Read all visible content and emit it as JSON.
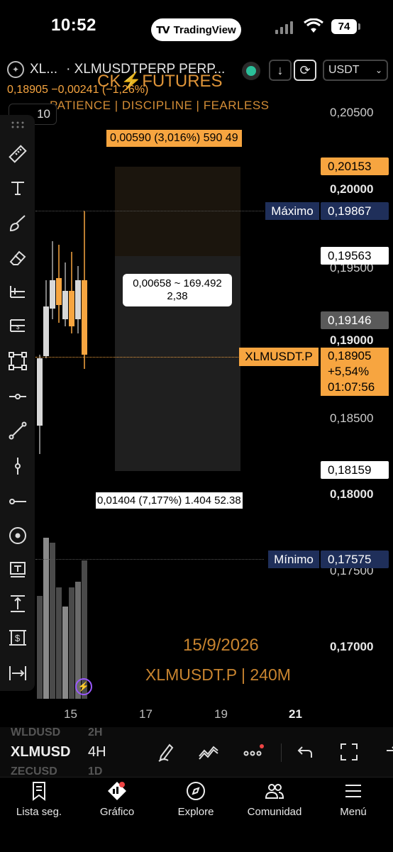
{
  "status": {
    "time": "10:52",
    "app_pill": "TradingView",
    "battery": "74"
  },
  "header": {
    "symbol_short": "XL...",
    "symbol_full": "· XLMUSDTPERP PERP...",
    "currency": "USDT",
    "price_line": "0,18905 −0,00241 (−1,26%)",
    "interval": "10"
  },
  "watermark": {
    "title": "CK⚡FUTURES",
    "subtitle": "PATIENCE | DISCIPLINE | FEARLESS",
    "date": "15/9/2026",
    "symbol_tf": "XLMUSDT.P | 240M"
  },
  "price_axis": {
    "levels": [
      "0,20500",
      "0,20000",
      "0,19500",
      "0,19000",
      "0,18500",
      "0,18000",
      "0,17500",
      "0,17000"
    ],
    "tags": {
      "orange_top": "0,20153",
      "maximo_label": "Máximo",
      "maximo_value": "0,19867",
      "white_upper": "0,19563",
      "gray": "0,19146",
      "current_symbol": "XLMUSDT.P",
      "current_price": "0,18905",
      "current_change": "+5,54%",
      "current_countdown": "01:07:56",
      "white_lower": "0,18159",
      "minimo_label": "Mínimo",
      "minimo_value": "0,17575"
    }
  },
  "position_tool": {
    "target_label": "0,00590 (3,016%) 590 49",
    "center_line1": "0,00658 ~ 169.492",
    "center_line2": "2,38",
    "stop_label": "0,01404 (7,177%) 1.404 52.38"
  },
  "time_axis": [
    "15",
    "17",
    "19",
    "21"
  ],
  "bottom_strip": {
    "ghost_top": "WLDUSD",
    "ghost_top_int": "2H",
    "symbol": "XLMUSD",
    "interval": "4H",
    "ghost_bottom": "ZECUSD",
    "ghost_bottom_int": "1D"
  },
  "tabs": [
    "Lista seg.",
    "Gráfico",
    "Explore",
    "Comunidad",
    "Menú"
  ],
  "colors": {
    "accent": "#f7a540",
    "navy": "#1f2f5a",
    "live_dot": "#2bbf9a"
  }
}
